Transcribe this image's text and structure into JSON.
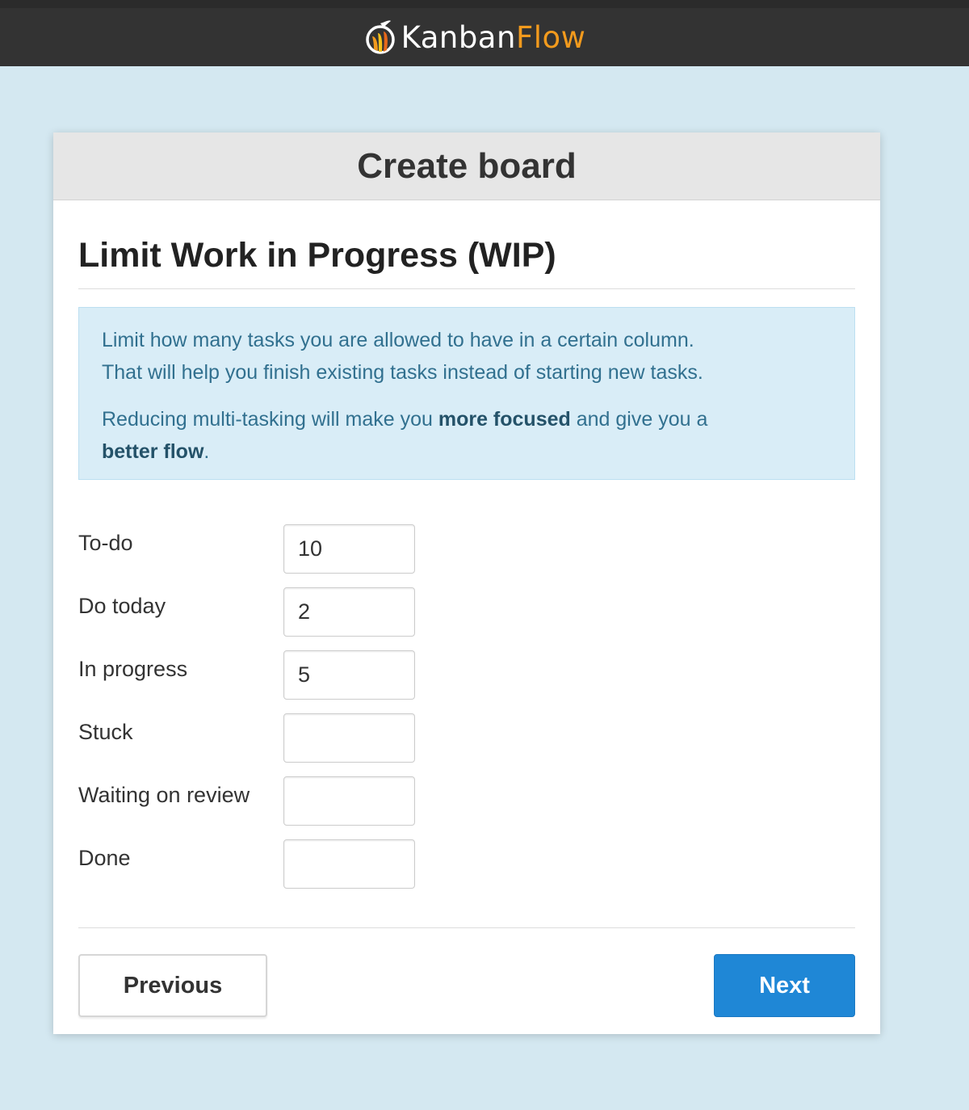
{
  "header": {
    "logo_part1": "Kanban",
    "logo_part2": "Flow",
    "logo_icon": "kanbanflow-flame-icon"
  },
  "dialog": {
    "title": "Create board",
    "section_title": "Limit Work in Progress (WIP)",
    "info": {
      "line1": "Limit how many tasks you are allowed to have in a certain column.",
      "line2": "That will help you finish existing tasks instead of starting new tasks.",
      "p2_before": "Reducing multi-tasking will make you ",
      "p2_bold1": "more focused",
      "p2_middle": " and give you a ",
      "p2_bold2": "better flow",
      "p2_after": "."
    },
    "columns": [
      {
        "label": "To-do",
        "value": "10"
      },
      {
        "label": "Do today",
        "value": "2"
      },
      {
        "label": "In progress",
        "value": "5"
      },
      {
        "label": "Stuck",
        "value": ""
      },
      {
        "label": "Waiting on review",
        "value": ""
      },
      {
        "label": "Done",
        "value": ""
      }
    ],
    "buttons": {
      "previous": "Previous",
      "next": "Next"
    }
  },
  "colors": {
    "page_background": "#d4e8f1",
    "topbar": "#333333",
    "brand_orange": "#f29a1d",
    "primary_button": "#1f87d6",
    "info_text": "#31708f",
    "info_background": "#d9edf7"
  }
}
